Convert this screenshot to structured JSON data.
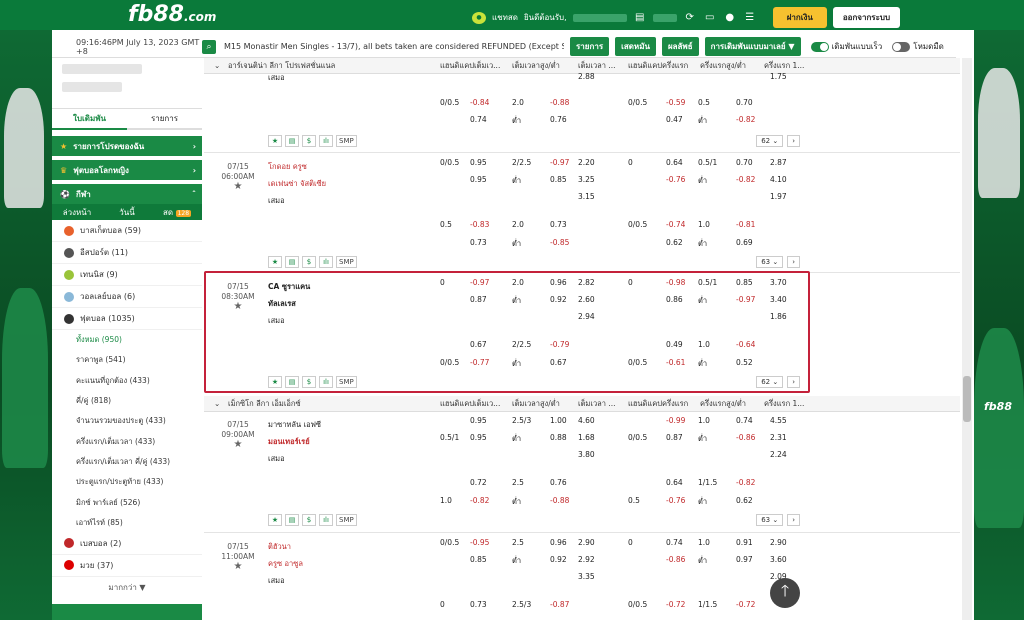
{
  "brand": {
    "logo": "fb88",
    "logo_suffix": ".com",
    "watermark": "fb88"
  },
  "header": {
    "chat": "แชทสด",
    "welcome": "ยินดีต้อนรับ,",
    "deposit": "ฝากเงิน",
    "logout": "ออกจากระบบ"
  },
  "ticker": {
    "time": "09:16:46PM July 13, 2023 GMT +8",
    "message": "M15 Monastir Men Singles - 13/7), all bets taken are considered REFUNDED (Except Set 1 &",
    "b1": "รายการ",
    "b2": "เสดหมัน",
    "b3": "ผลลัพธ์",
    "b4": "การเดิมพันแบบมาเลย์ ▼",
    "t1": "เดิมพันแบบเร็ว",
    "t2": "โหมดมืด"
  },
  "side": {
    "bt1": "ใบเดิมพัน",
    "bt2": "รายการ",
    "g1": "รายการโปรดของฉัน",
    "g2": "ฟุตบอลโลกหญิง",
    "g3": "กีฬา",
    "s1": "ล่วงหน้า",
    "s2": "วันนี้",
    "s3": "สด",
    "badge": "128",
    "sports": [
      {
        "n": "บาสเก็ตบอล (59)",
        "c": "#e8612c"
      },
      {
        "n": "อีสปอร์ต (11)",
        "c": "#555"
      },
      {
        "n": "เทนนิส (9)",
        "c": "#9ac43a"
      },
      {
        "n": "วอลเลย์บอล (6)",
        "c": "#8ab8d8"
      },
      {
        "n": "ฟุตบอล (1035)",
        "c": "#333"
      }
    ],
    "subs": [
      "ทั้งหมด (950)",
      "ราคาพูล (541)",
      "คะแนนที่ถูกต้อง (433)",
      "คี่/คู่ (818)",
      "จำนวนรวมของประตู (433)",
      "ครึ่งแรก/เต็มเวลา (433)",
      "ครึ่งแรก/เต็มเวลา คี่/คู่ (433)",
      "ประตูแรก/ประตูท้าย (433)",
      "มิกซ์ พาร์เลย์ (526)",
      "เอาท์ไรท์ (85)"
    ],
    "sports2": [
      {
        "n": "เบสบอล (2)",
        "c": "#c0282a"
      },
      {
        "n": "มวย (37)",
        "c": "#d00"
      }
    ],
    "more": "มากกว่า ▼"
  },
  "headers": {
    "h1": "แฮนดิแคปเต็มเว...",
    "h2": "เต็มเวลาสูง/ต่ำ",
    "h3": "เต็มเวลา ...",
    "h4": "แฮนดิแคปครึ่งแรก",
    "h5": "ครึ่งแรกสูง/ต่ำ",
    "h6": "ครึ่งแรก 1..."
  },
  "league1": "อาร์เจนติน่า ลีกา โปรเฟสชั่นแนล",
  "league2": "เม็กซิโก ลีกา เอ็มเอ็กซ์",
  "r0": {
    "draw": "เสมอ",
    "v1": "2.88",
    "v2": "1.75",
    "a1": "0/0.5",
    "a2": "-0.84",
    "a3": "2.0",
    "a4": "-0.88",
    "a5": "0/0.5",
    "a6": "-0.59",
    "a7": "0.5",
    "a8": "0.70",
    "b2": "0.74",
    "b3": "ต่ำ",
    "b4": "0.76",
    "b6": "0.47",
    "b7": "ต่ำ",
    "b8": "-0.82",
    "pg": "62"
  },
  "m1": {
    "date": "07/15",
    "time": "06:00AM",
    "t1": "โกดอย ครูซ",
    "t2": "เดเฟนซ่า จัสติเซีย",
    "draw": "เสมอ",
    "r": [
      [
        "0/0.5",
        "0.95",
        "2/2.5",
        "-0.97",
        "2.20",
        "0",
        "0.64",
        "0.5/1",
        "0.70",
        "2.87"
      ],
      [
        "",
        "0.95",
        "ต่ำ",
        "0.85",
        "3.25",
        "",
        "-0.76",
        "ต่ำ",
        "-0.82",
        "4.10"
      ],
      [
        "",
        "",
        "",
        "",
        "3.15",
        "",
        "",
        "",
        "",
        "1.97"
      ],
      [
        "0.5",
        "-0.83",
        "2.0",
        "0.73",
        "",
        "0/0.5",
        "-0.74",
        "1.0",
        "-0.81",
        ""
      ],
      [
        "",
        "0.73",
        "ต่ำ",
        "-0.85",
        "",
        "",
        "0.62",
        "ต่ำ",
        "0.69",
        ""
      ]
    ],
    "pg": "63"
  },
  "m2": {
    "date": "07/15",
    "time": "08:30AM",
    "t1": "CA ซูราแคน",
    "t2": "ทัลเลเรส",
    "draw": "เสมอ",
    "r": [
      [
        "0",
        "-0.97",
        "2.0",
        "0.96",
        "2.82",
        "0",
        "-0.98",
        "0.5/1",
        "0.85",
        "3.70"
      ],
      [
        "",
        "0.87",
        "ต่ำ",
        "0.92",
        "2.60",
        "",
        "0.86",
        "ต่ำ",
        "-0.97",
        "3.40"
      ],
      [
        "",
        "",
        "",
        "",
        "2.94",
        "",
        "",
        "",
        "",
        "1.86"
      ],
      [
        "",
        "0.67",
        "2/2.5",
        "-0.79",
        "",
        "",
        "0.49",
        "1.0",
        "-0.64",
        ""
      ],
      [
        "0/0.5",
        "-0.77",
        "ต่ำ",
        "0.67",
        "",
        "0/0.5",
        "-0.61",
        "ต่ำ",
        "0.52",
        ""
      ]
    ],
    "pg": "62"
  },
  "m3": {
    "date": "07/15",
    "time": "09:00AM",
    "t1": "มาซาทลัน เอฟซี",
    "t2": "มอนเทอร์เรย์",
    "draw": "เสมอ",
    "r": [
      [
        "",
        "0.95",
        "2.5/3",
        "1.00",
        "4.60",
        "",
        "-0.99",
        "1.0",
        "0.74",
        "4.55"
      ],
      [
        "0.5/1",
        "0.95",
        "ต่ำ",
        "0.88",
        "1.68",
        "0/0.5",
        "0.87",
        "ต่ำ",
        "-0.86",
        "2.31"
      ],
      [
        "",
        "",
        "",
        "",
        "3.80",
        "",
        "",
        "",
        "",
        "2.24"
      ],
      [
        "",
        "0.72",
        "2.5",
        "0.76",
        "",
        "",
        "0.64",
        "1/1.5",
        "-0.82",
        ""
      ],
      [
        "1.0",
        "-0.82",
        "ต่ำ",
        "-0.88",
        "",
        "0.5",
        "-0.76",
        "ต่ำ",
        "0.62",
        ""
      ]
    ],
    "pg": "63"
  },
  "m4": {
    "date": "07/15",
    "time": "11:00AM",
    "t1": "ติฮัวนา",
    "t2": "ครูซ อาซูล",
    "draw": "เสมอ",
    "r": [
      [
        "0/0.5",
        "-0.95",
        "2.5",
        "0.96",
        "2.90",
        "0",
        "0.74",
        "1.0",
        "0.91",
        "2.90"
      ],
      [
        "",
        "0.85",
        "ต่ำ",
        "0.92",
        "2.92",
        "",
        "-0.86",
        "ต่ำ",
        "0.97",
        "3.60"
      ],
      [
        "",
        "",
        "",
        "",
        "3.35",
        "",
        "",
        "",
        "",
        "2.09"
      ],
      [
        "0",
        "0.73",
        "2.5/3",
        "-0.87",
        "",
        "0/0.5",
        "-0.72",
        "1/1.5",
        "-0.72",
        ""
      ]
    ]
  },
  "icons": {
    "smp": "SMP"
  }
}
